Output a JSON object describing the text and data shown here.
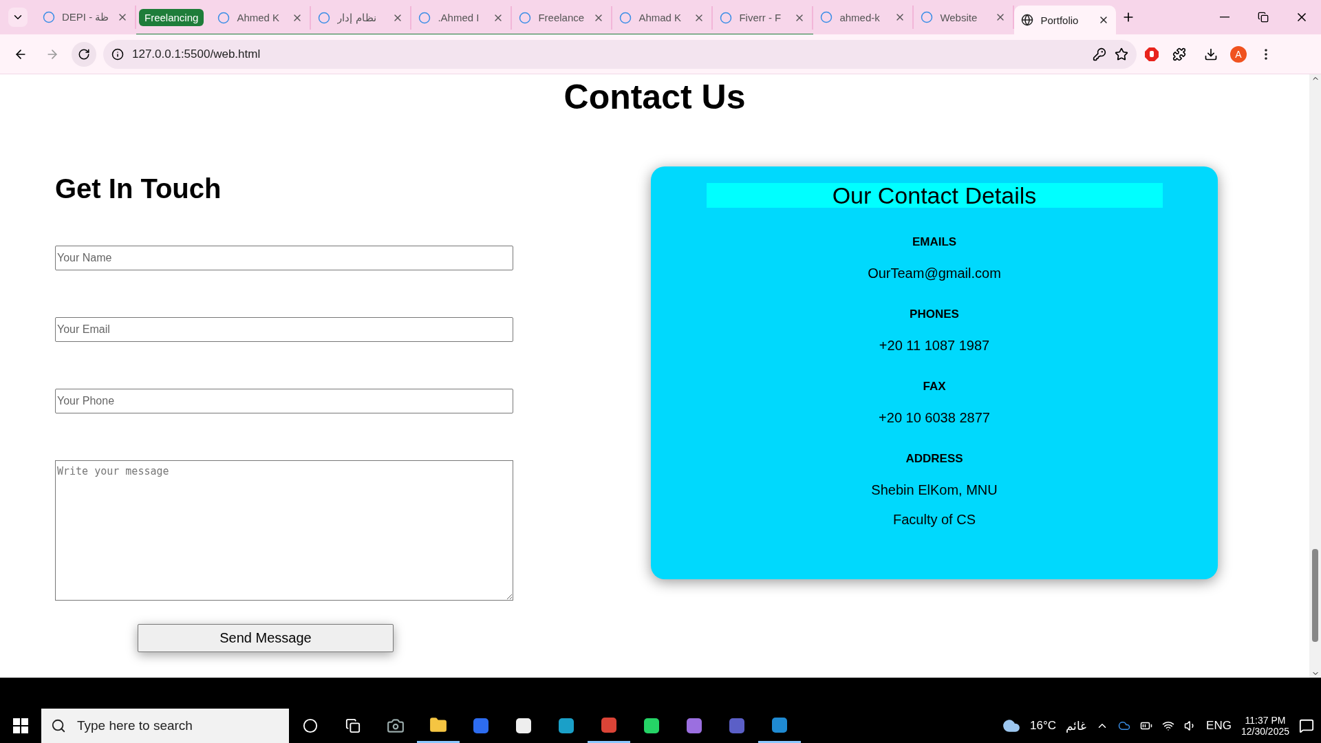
{
  "browser": {
    "tabs": [
      {
        "kind": "tab",
        "title": "DEPI - ظة",
        "selected": false
      },
      {
        "kind": "group",
        "title": "Freelancing",
        "children": [
          {
            "kind": "tab",
            "title": "Ahmed K",
            "selected": false
          },
          {
            "kind": "tab",
            "title": "نظام إدار",
            "selected": false
          },
          {
            "kind": "tab",
            "title": ".Ahmed I",
            "selected": false
          },
          {
            "kind": "tab",
            "title": "Freelance",
            "selected": false
          },
          {
            "kind": "tab",
            "title": "Ahmad K",
            "selected": false
          },
          {
            "kind": "tab",
            "title": "Fiverr - F",
            "selected": false
          }
        ]
      },
      {
        "kind": "tab",
        "title": "ahmed-k",
        "selected": false
      },
      {
        "kind": "tab",
        "title": "Website",
        "selected": false
      },
      {
        "kind": "tab",
        "title": "Portfolio",
        "selected": true
      }
    ],
    "url": "127.0.0.1:5500/web.html",
    "profile_initial": "A"
  },
  "page": {
    "title": "Contact Us",
    "form": {
      "heading": "Get In Touch",
      "fields": [
        {
          "kind": "input",
          "placeholder": "Your Name"
        },
        {
          "kind": "input",
          "placeholder": "Your Email"
        },
        {
          "kind": "input",
          "placeholder": "Your Phone"
        },
        {
          "kind": "textarea",
          "placeholder": "Write your message"
        }
      ],
      "button": "Send Message"
    },
    "details": {
      "title": "Our Contact Details",
      "items": [
        {
          "kind": "heading",
          "text": "EMAILS"
        },
        {
          "kind": "value",
          "text": "OurTeam@gmail.com"
        },
        {
          "kind": "heading",
          "text": "PHONES"
        },
        {
          "kind": "value",
          "text": "+20 11 1087 1987"
        },
        {
          "kind": "heading",
          "text": "FAX"
        },
        {
          "kind": "value",
          "text": "+20 10 6038 2877"
        },
        {
          "kind": "heading",
          "text": "ADDRESS"
        },
        {
          "kind": "value",
          "text": "Shebin ElKom, MNU"
        },
        {
          "kind": "value",
          "text": "Faculty of CS"
        }
      ]
    }
  },
  "taskbar": {
    "search_placeholder": "Type here to search",
    "weather": {
      "temp": "16°C",
      "condition": "غائم"
    },
    "language": "ENG",
    "time": "11:37 PM",
    "date": "12/30/2025"
  }
}
